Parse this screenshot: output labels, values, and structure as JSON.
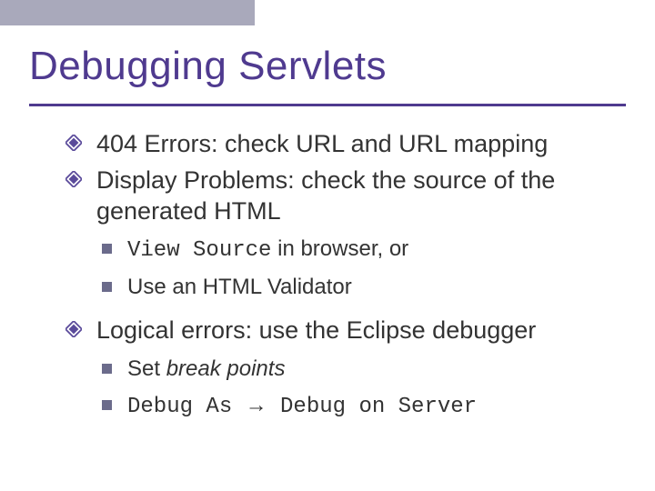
{
  "title": "Debugging Servlets",
  "bullets": {
    "b1": "404 Errors: check URL and URL mapping",
    "b2": "Display Problems: check the source of the generated HTML",
    "b2_1_code": "View Source",
    "b2_1_tail": " in browser, or",
    "b2_2": "Use an HTML Validator",
    "b3": "Logical errors: use the Eclipse debugger",
    "b3_1_pre": "Set ",
    "b3_1_italic": "break points",
    "b3_2_a": "Debug As ",
    "b3_2_arrow": "→",
    "b3_2_b": " Debug on Server"
  }
}
